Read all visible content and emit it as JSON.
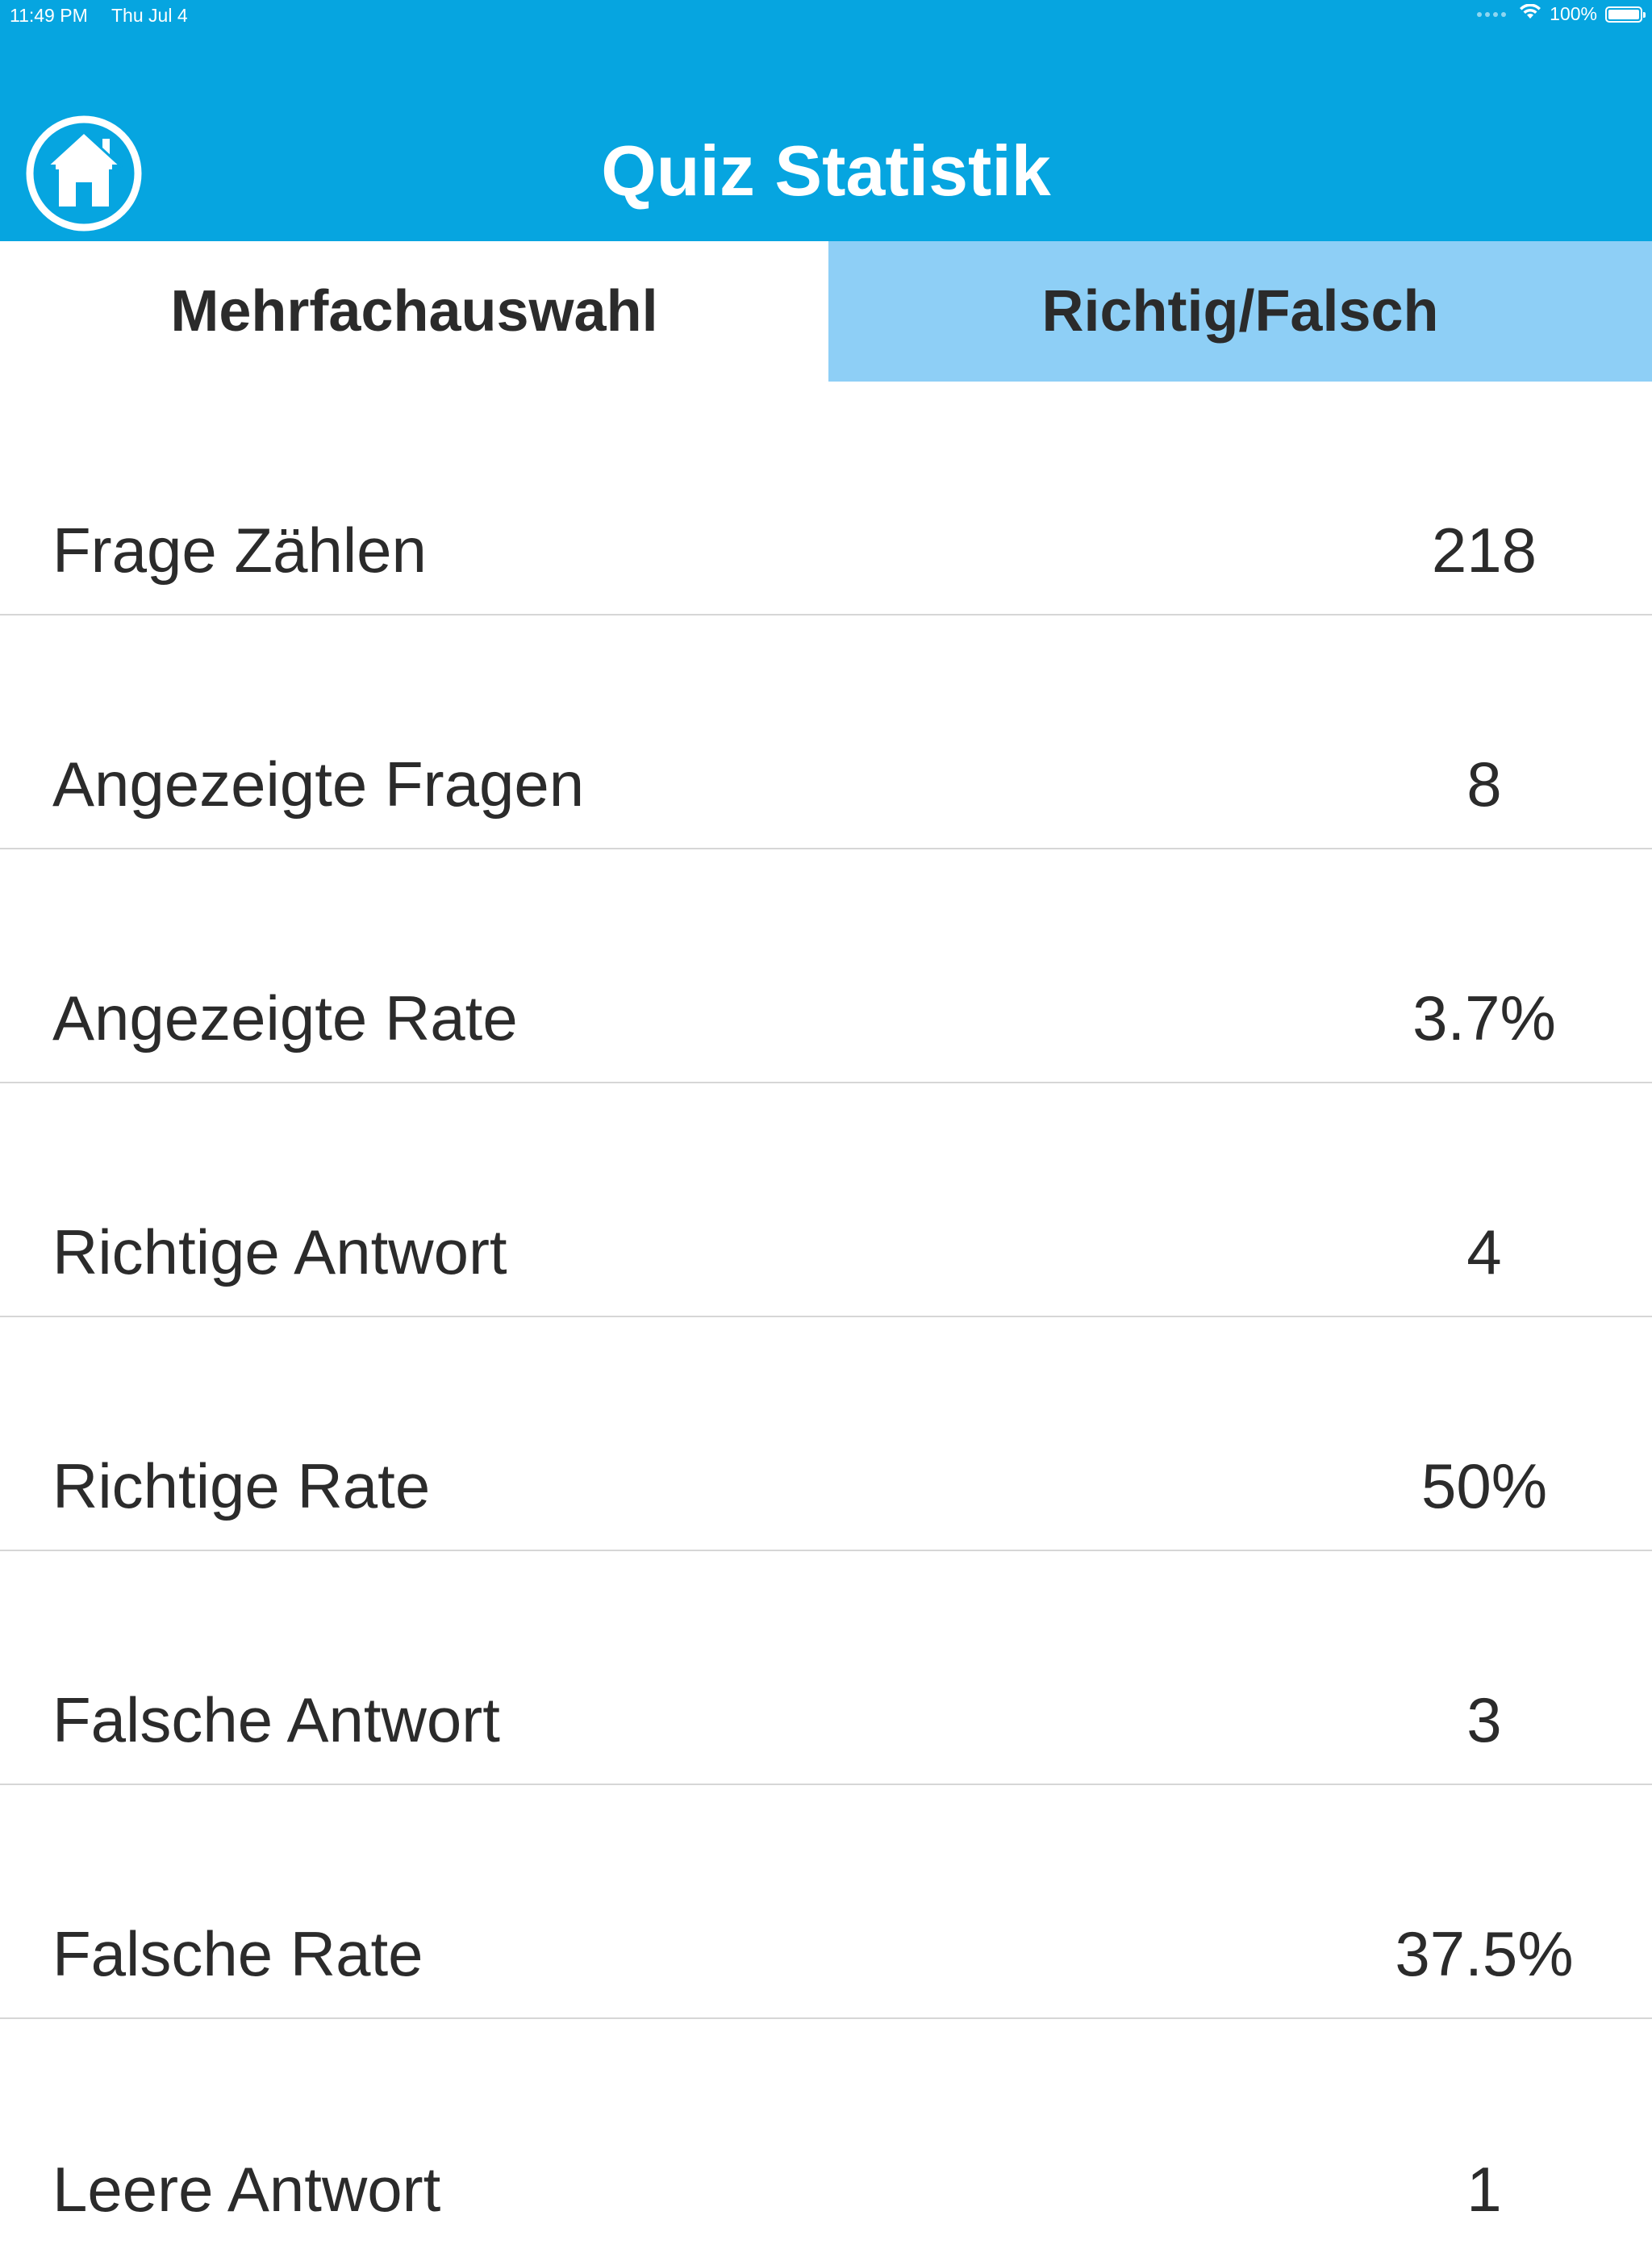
{
  "status_bar": {
    "time": "11:49 PM",
    "date": "Thu Jul 4",
    "battery": "100%",
    "battery_level": 1.0
  },
  "header": {
    "title": "Quiz Statistik",
    "home_icon": "home-icon",
    "background_color": "#06a5e0"
  },
  "tabs": [
    {
      "label": "Mehrfachauswahl",
      "selected": false
    },
    {
      "label": "Richtig/Falsch",
      "selected": true
    }
  ],
  "tab_selected_color": "#8ecff6",
  "stats": [
    {
      "label": "Frage Zählen",
      "value": "218"
    },
    {
      "label": "Angezeigte Fragen",
      "value": "8"
    },
    {
      "label": "Angezeigte Rate",
      "value": "3.7%"
    },
    {
      "label": "Richtige Antwort",
      "value": "4"
    },
    {
      "label": "Richtige Rate",
      "value": "50%"
    },
    {
      "label": "Falsche Antwort",
      "value": "3"
    },
    {
      "label": "Falsche Rate",
      "value": "37.5%"
    },
    {
      "label": "Leere Antwort",
      "value": "1"
    }
  ]
}
